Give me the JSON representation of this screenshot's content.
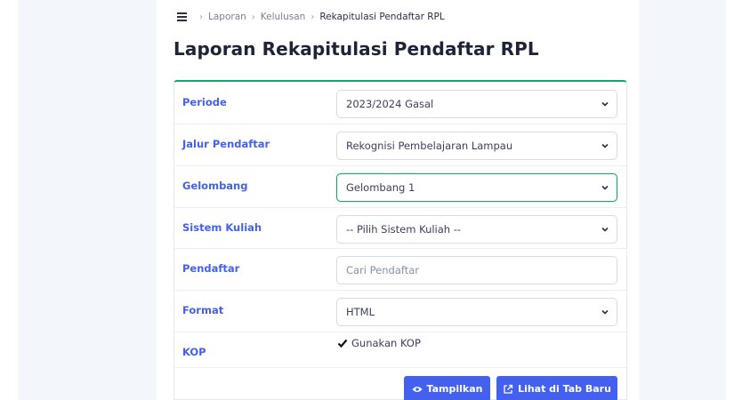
{
  "breadcrumb": {
    "items": [
      "Laporan",
      "Kelulusan",
      "Rekapitulasi Pendaftar RPL"
    ]
  },
  "page": {
    "title": "Laporan Rekapitulasi Pendaftar RPL"
  },
  "form": {
    "periode": {
      "label": "Periode",
      "value": "2023/2024 Gasal"
    },
    "jalur": {
      "label": "Jalur Pendaftar",
      "value": "Rekognisi Pembelajaran Lampau"
    },
    "gelombang": {
      "label": "Gelombang",
      "value": "Gelombang 1"
    },
    "sistem": {
      "label": "Sistem Kuliah",
      "value": "-- Pilih Sistem Kuliah --"
    },
    "pendaftar": {
      "label": "Pendaftar",
      "value": "",
      "placeholder": "Cari Pendaftar"
    },
    "format": {
      "label": "Format",
      "value": "HTML"
    },
    "kop": {
      "label": "KOP",
      "checkbox_label": "Gunakan KOP",
      "checked": true
    }
  },
  "actions": {
    "show_label": "Tampilkan",
    "new_tab_label": "Lihat di Tab Baru"
  },
  "colors": {
    "accent": "#4361ee",
    "success": "#1aa36b"
  },
  "icons": {
    "menu": "hamburger-icon",
    "show": "eye-icon",
    "new_tab": "external-link-icon"
  }
}
